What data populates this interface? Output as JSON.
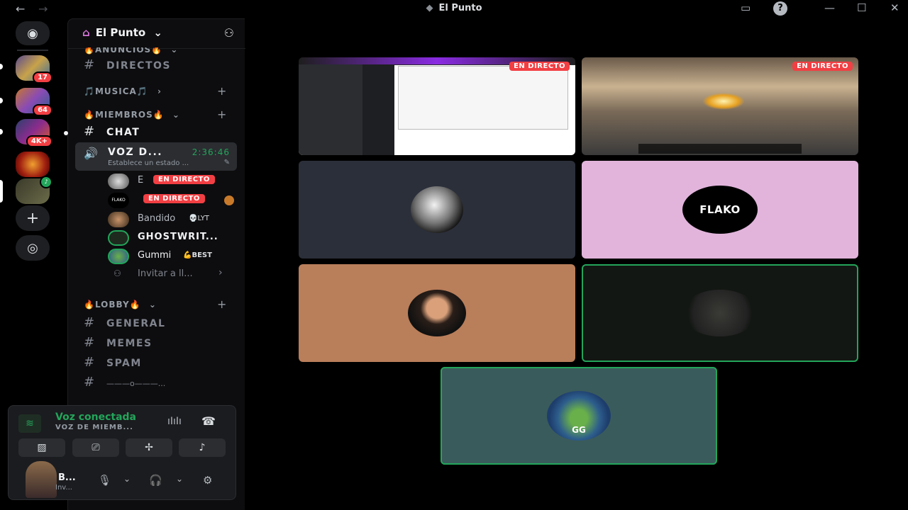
{
  "titlebar": {
    "back": "←",
    "forward": "→",
    "title": "El Punto",
    "title_icon": "◆",
    "inbox_icon": "▭",
    "help_icon": "?",
    "minimize": "—",
    "maximize": "☐",
    "close": "✕"
  },
  "rail": {
    "home_icon": "◉",
    "badges": [
      "17",
      "64",
      "4K+"
    ],
    "add_server_icon": "+",
    "discover_icon": "◎"
  },
  "guild": {
    "name": "El Punto",
    "chevron": "⌄",
    "invite_icon": "⚇"
  },
  "categories": {
    "anuncios": "🔥ANUNCIOS🔥",
    "musica": "🎵MUSICA🎵",
    "miembros": "🔥MIEMBROS🔥",
    "lobby": "🔥LOBBY🔥",
    "plus": "+",
    "chevron": "⌄",
    "chevron_right": "›"
  },
  "channels": {
    "hash": "#",
    "directos": "DIRECTOS",
    "chat": "CHAT",
    "general": "GENERAL",
    "memes": "MEMES",
    "spam": "SPAM",
    "divider": "———o———...",
    "voice_icon": "🔊"
  },
  "voice_channel": {
    "name": "VOZ D...",
    "time": "2:36:46",
    "status": "Establece un estado ...",
    "edit_icon": "✎"
  },
  "voice_users": [
    {
      "name": "E",
      "live": "EN DIRECTO"
    },
    {
      "name": "FLAKO",
      "live": "EN DIRECTO"
    },
    {
      "name": "Bandido",
      "tag": "💀LYT"
    },
    {
      "name": "GHOSTWRIT...",
      "tag": ""
    },
    {
      "name": "Gummi",
      "tag": "💪BEST"
    }
  ],
  "invite_row": {
    "label": "Invitar a ll...",
    "chevron": "›"
  },
  "user_panel": {
    "voice_title": "Voz conectada",
    "voice_sub": "VOZ DE MIEMB...",
    "signal_icon": "≋",
    "wave_icon": "ıIıIı",
    "hangup_icon": "☎",
    "btn_camera": "▨",
    "btn_share": "⎚",
    "btn_activity": "✢",
    "btn_soundboard": "♪",
    "me_name": "B...",
    "me_status": "Inv...",
    "mic_icon": "🎙",
    "headphones_icon": "🎧",
    "settings_icon": "⚙",
    "caret": "⌄"
  },
  "stage": {
    "live_label": "EN DIRECTO",
    "flako_logo": "FLAKO",
    "gg_logo": "GG"
  },
  "colors": {
    "accent_green": "#23a55a",
    "live_red": "#f23f43",
    "tile_dark": "#2b2f3a",
    "tile_pink": "#e2b4dc",
    "tile_tan": "#b97e5a",
    "tile_black": "#131713",
    "tile_teal": "#3a5b5b"
  }
}
